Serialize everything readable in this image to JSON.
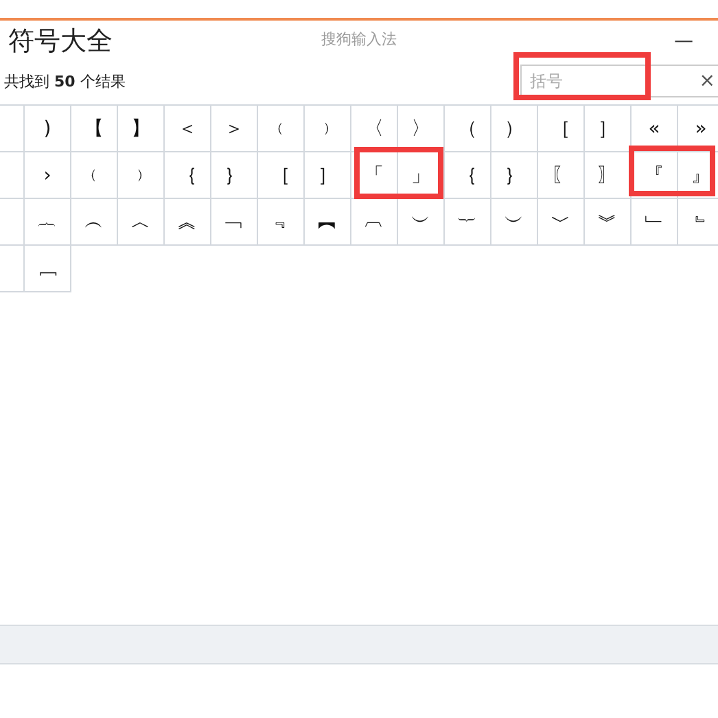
{
  "window": {
    "title": "符号大全",
    "app_name": "搜狗输入法",
    "minimize": "—"
  },
  "result_summary": {
    "prefix": "共找到",
    "count": "50",
    "suffix": "个结果"
  },
  "search": {
    "placeholder": "括号",
    "clear": "×"
  },
  "symbols": [
    [
      ")",
      "【",
      "】",
      "＜",
      "＞",
      "﹙",
      "﹚",
      "〈",
      "〉",
      "（",
      "）",
      "［",
      "］",
      "«",
      "»"
    ],
    [
      "›",
      "﹙",
      "﹚",
      "｛",
      "｝",
      "［",
      "］",
      "「",
      "」",
      "｛",
      "｝",
      "〖",
      "〗",
      "『",
      "』"
    ],
    [
      "︷",
      "︵",
      "︿",
      "︽",
      "﹁",
      "﹃",
      "︻",
      "︹",
      "︶",
      "︸",
      "︶",
      "﹀",
      "︾",
      "﹂",
      "﹄"
    ],
    [
      "﹈"
    ]
  ]
}
